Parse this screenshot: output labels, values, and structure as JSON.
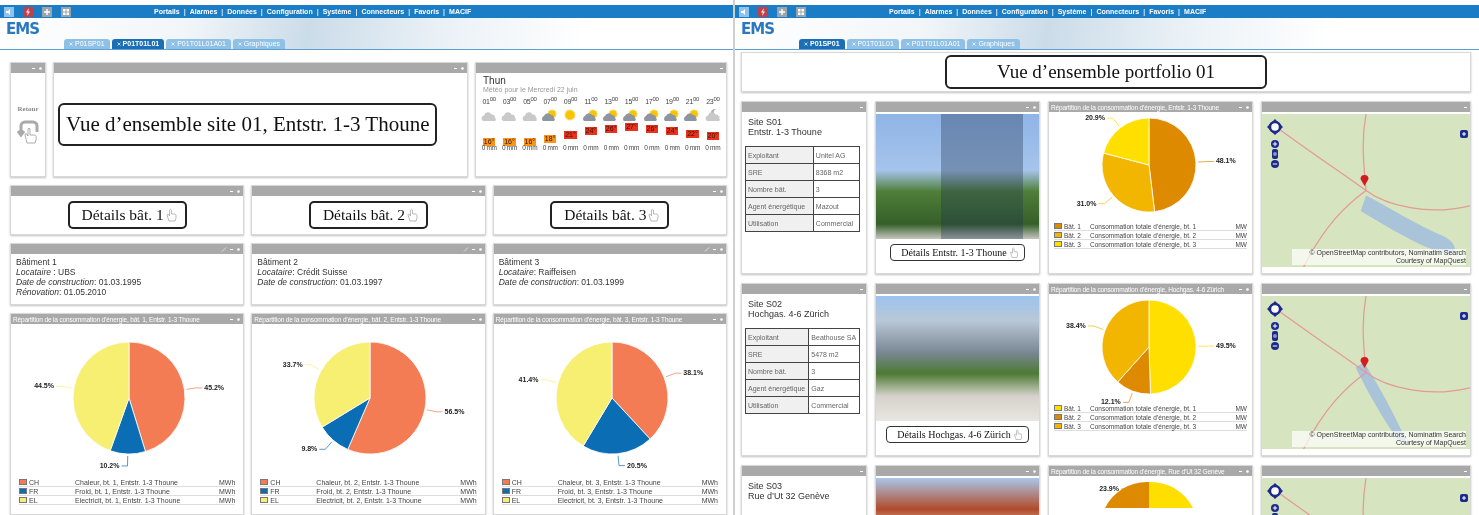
{
  "left_screen": {
    "menu": {
      "links": [
        "Portails",
        "Alarmes",
        "Données",
        "Configuration",
        "Système",
        "Connecteurs",
        "Favoris",
        "MACIF"
      ],
      "separator": "|"
    },
    "logo": "EMS",
    "tabs": [
      {
        "label": "P01SP01",
        "selected": false
      },
      {
        "label": "P01T01L01",
        "selected": true
      },
      {
        "label": "P01T01L01A01",
        "selected": false
      },
      {
        "label": "Graphiques",
        "selected": false
      }
    ],
    "back": {
      "label": "Retour"
    },
    "title": "Vue d’ensemble site 01, Entstr. 1-3 Thoune",
    "weather": {
      "city": "Thun",
      "subtitle": "Météo pour le Mercredi 22 juin",
      "hours": [
        {
          "time": "01$^{00}$",
          "kind": "cloud",
          "temp": "16°",
          "color": "#f7941d",
          "rain": "0 mm"
        },
        {
          "time": "03$^{00}$",
          "kind": "cloud",
          "temp": "16°",
          "color": "#f7941d",
          "rain": "0 mm"
        },
        {
          "time": "05$^{00}$",
          "kind": "cloud",
          "temp": "16°",
          "color": "#f7941d",
          "rain": "0 mm"
        },
        {
          "time": "07$^{00}$",
          "kind": "sun-cloud",
          "temp": "18°",
          "color": "#f7941d",
          "rain": "0 mm"
        },
        {
          "time": "09$^{00}$",
          "kind": "sun",
          "temp": "21°",
          "color": "#e8321e",
          "rain": "0 mm"
        },
        {
          "time": "11$^{00}$",
          "kind": "sun-cloud",
          "temp": "24°",
          "color": "#e8321e",
          "rain": "0 mm"
        },
        {
          "time": "13$^{00}$",
          "kind": "sun-cloud",
          "temp": "26°",
          "color": "#e8321e",
          "rain": "0 mm"
        },
        {
          "time": "15$^{00}$",
          "kind": "sun-cloud",
          "temp": "27°",
          "color": "#e8321e",
          "rain": "0 mm"
        },
        {
          "time": "17$^{00}$",
          "kind": "sun-cloud",
          "temp": "26°",
          "color": "#e8321e",
          "rain": "0 mm"
        },
        {
          "time": "19$^{00}$",
          "kind": "sun-cloud",
          "temp": "24°",
          "color": "#e8321e",
          "rain": "0 mm"
        },
        {
          "time": "21$^{00}$",
          "kind": "sun-cloud",
          "temp": "22°",
          "color": "#e8321e",
          "rain": "0 mm"
        },
        {
          "time": "23$^{00}$",
          "kind": "moon-cloud",
          "temp": "20°",
          "color": "#e8321e",
          "rain": "0 mm"
        }
      ]
    },
    "detail_buttons": [
      "Détails bât. 1",
      "Détails bât. 2",
      "Détails bât. 3"
    ],
    "buildings": [
      {
        "lines": [
          "Bâtiment 1",
          "*Locataire* : UBS",
          "*Date de construction*: 01.03.1995",
          "*Rénovation*: 01.05.2010"
        ]
      },
      {
        "lines": [
          "Bâtiment 2",
          "*Locataire*: Crédit Suisse",
          "*Date de construction*: 01.03.1997"
        ]
      },
      {
        "lines": [
          "Bâtiment 3",
          "*Locataire*: Raiffeisen",
          "*Date de construction*: 01.03.1999"
        ]
      }
    ],
    "charts": [
      {
        "chart_data": {
          "type": "pie",
          "title": "Répartition de la consommation d’énergie, bât. 1, Entstr. 1-3 Thoune",
          "categories": [
            "CH",
            "FR",
            "EL"
          ],
          "values": [
            45.2,
            10.2,
            44.5
          ],
          "legend": "bottom",
          "value_labels": [
            "45.2%",
            "10.2%",
            "44.5%"
          ]
        },
        "legend": [
          {
            "label": "Chaleur, bt. 1, Entstr. 1-3 Thoune",
            "unit": "MWh",
            "color": "#f47c54"
          },
          {
            "label": "Froid, bt. 1, Entstr. 1-3 Thoune",
            "unit": "MWh",
            "color": "#0b6db4"
          },
          {
            "label": "Electricit, bt. 1, Entstr. 1-3 Thoune",
            "unit": "MWh",
            "color": "#f7ef72"
          }
        ]
      },
      {
        "chart_data": {
          "type": "pie",
          "title": "Répartition de la consommation d’énergie, bât. 2, Entstr. 1-3 Thoune",
          "categories": [
            "CH",
            "FR",
            "EL"
          ],
          "values": [
            56.5,
            9.8,
            33.7
          ],
          "legend": "bottom",
          "value_labels": [
            "56.5%",
            "9.8%",
            "33.7%"
          ]
        },
        "legend": [
          {
            "label": "Chaleur, bt. 2, Entstr. 1-3 Thoune",
            "unit": "MWh",
            "color": "#f47c54"
          },
          {
            "label": "Froid, bt. 2, Entstr. 1-3 Thoune",
            "unit": "MWh",
            "color": "#0b6db4"
          },
          {
            "label": "Electricit, bt. 2, Entstr. 1-3 Thoune",
            "unit": "MWh",
            "color": "#f7ef72"
          }
        ]
      },
      {
        "chart_data": {
          "type": "pie",
          "title": "Répartition de la consommation d’énergie, bât. 3, Entstr. 1-3 Thoune",
          "categories": [
            "CH",
            "FR",
            "EL"
          ],
          "values": [
            38.1,
            20.5,
            41.4
          ],
          "legend": "bottom",
          "value_labels": [
            "38.1%",
            "20.5%",
            "41.4%"
          ]
        },
        "legend": [
          {
            "label": "Chaleur, bt. 3, Entstr. 1-3 Thoune",
            "unit": "MWh",
            "color": "#f47c54"
          },
          {
            "label": "Froid, bt. 3, Entstr. 1-3 Thoune",
            "unit": "MWh",
            "color": "#0b6db4"
          },
          {
            "label": "Electricit, bt. 3, Entstr. 1-3 Thoune",
            "unit": "MWh",
            "color": "#f7ef72"
          }
        ]
      }
    ]
  },
  "right_screen": {
    "menu": {
      "links": [
        "Portails",
        "Alarmes",
        "Données",
        "Configuration",
        "Système",
        "Connecteurs",
        "Favoris",
        "MACIF"
      ],
      "separator": "|"
    },
    "logo": "EMS",
    "tabs": [
      {
        "label": "P01SP01",
        "selected": true
      },
      {
        "label": "P01T01L01",
        "selected": false
      },
      {
        "label": "P01T01L01A01",
        "selected": false
      },
      {
        "label": "Graphiques",
        "selected": false
      }
    ],
    "title": "Vue d’ensemble portfolio 01",
    "sites": [
      {
        "name": "Site S01",
        "address": "Entstr. 1-3 Thoune",
        "facts": [
          {
            "label": "Exploitant",
            "value": "Unitel AG"
          },
          {
            "label": "SRE",
            "value": "8368 m2"
          },
          {
            "label": "Nombre bât.",
            "value": "3"
          },
          {
            "label": "Agent énergétique",
            "value": "Mazout"
          },
          {
            "label": "Utilisation",
            "value": "Commercial"
          }
        ],
        "button": "Détails Entstr. 1-3 Thoune",
        "chart": {
          "chart_data": {
            "type": "pie",
            "title": "Répartition de la consommation d’énergie, Entstr. 1-3 Thoune",
            "categories": [
              "Bât. 1",
              "Bât. 2",
              "Bât. 3"
            ],
            "values": [
              48.1,
              31.0,
              20.9
            ],
            "legend": "bottom",
            "value_labels": [
              "48.1%",
              "31.0%",
              "20.9%"
            ]
          },
          "legend": [
            {
              "label": "Consommation totale d’énergie, bt. 1",
              "unit": "MW",
              "color": "#dd8a00"
            },
            {
              "label": "Consommation totale d’énergie, bt. 2",
              "unit": "MW",
              "color": "#f2b600"
            },
            {
              "label": "Consommation totale d’énergie, bt. 3",
              "unit": "MW",
              "color": "#ffdf00"
            }
          ]
        },
        "map": {
          "attribution": "© OpenStreetMap contributors, Nominatim Search Courtesy of MapQuest"
        }
      },
      {
        "name": "Site S02",
        "address": "Hochgas. 4-6 Zürich",
        "facts": [
          {
            "label": "Exploitant",
            "value": "Beathouse SA"
          },
          {
            "label": "SRE",
            "value": "5478 m2"
          },
          {
            "label": "Nombre bât.",
            "value": "3"
          },
          {
            "label": "Agent énergétique",
            "value": "Gaz"
          },
          {
            "label": "Utilisation",
            "value": "Commercial"
          }
        ],
        "button": "Détails Hochgas. 4-6 Zürich",
        "chart": {
          "chart_data": {
            "type": "pie",
            "title": "Répartition de la consommation d’énergie, Hochgas. 4-6 Zürich",
            "categories": [
              "Bât. 1",
              "Bât. 2",
              "Bât. 3"
            ],
            "values": [
              49.5,
              12.1,
              38.4
            ],
            "legend": "bottom",
            "value_labels": [
              "49.5%",
              "12.1%",
              "38.4%"
            ]
          },
          "legend": [
            {
              "label": "Consommation totale d’énergie, bt. 1",
              "unit": "MW",
              "color": "#ffdf00"
            },
            {
              "label": "Consommation totale d’énergie, bt. 2",
              "unit": "MW",
              "color": "#dd8a00"
            },
            {
              "label": "Consommation totale d’énergie, bt. 3",
              "unit": "MW",
              "color": "#f2b600"
            }
          ]
        },
        "map": {
          "attribution": "© OpenStreetMap contributors, Nominatim Search Courtesy of MapQuest"
        }
      },
      {
        "name": "Site S03",
        "address": "Rue d’Ut 32 Genève",
        "chart": {
          "title": "Répartition de la consommation d’énergie, Rue d’Ut 32 Genève",
          "value_labels": [
            "23.9%"
          ]
        }
      }
    ]
  }
}
